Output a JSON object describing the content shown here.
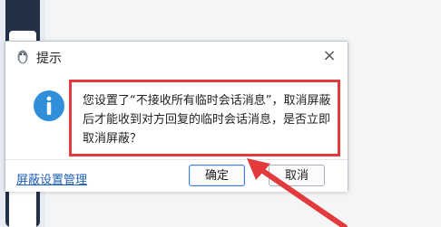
{
  "dialog": {
    "title": "提示",
    "close_glyph": "×",
    "message": "您设置了“不接收所有临时会话消息”，取消屏蔽后才能收到对方回复的临时会话消息，是否立即取消屏蔽？",
    "link_label": "屏蔽设置管理",
    "confirm_label": "确定",
    "cancel_label": "取消"
  },
  "icons": {
    "title": "qq-penguin-icon",
    "info": "info-icon",
    "close": "close-icon"
  },
  "colors": {
    "highlight": "#e23a3d",
    "info_blue": "#2f8fdb",
    "link": "#1e60b6"
  }
}
